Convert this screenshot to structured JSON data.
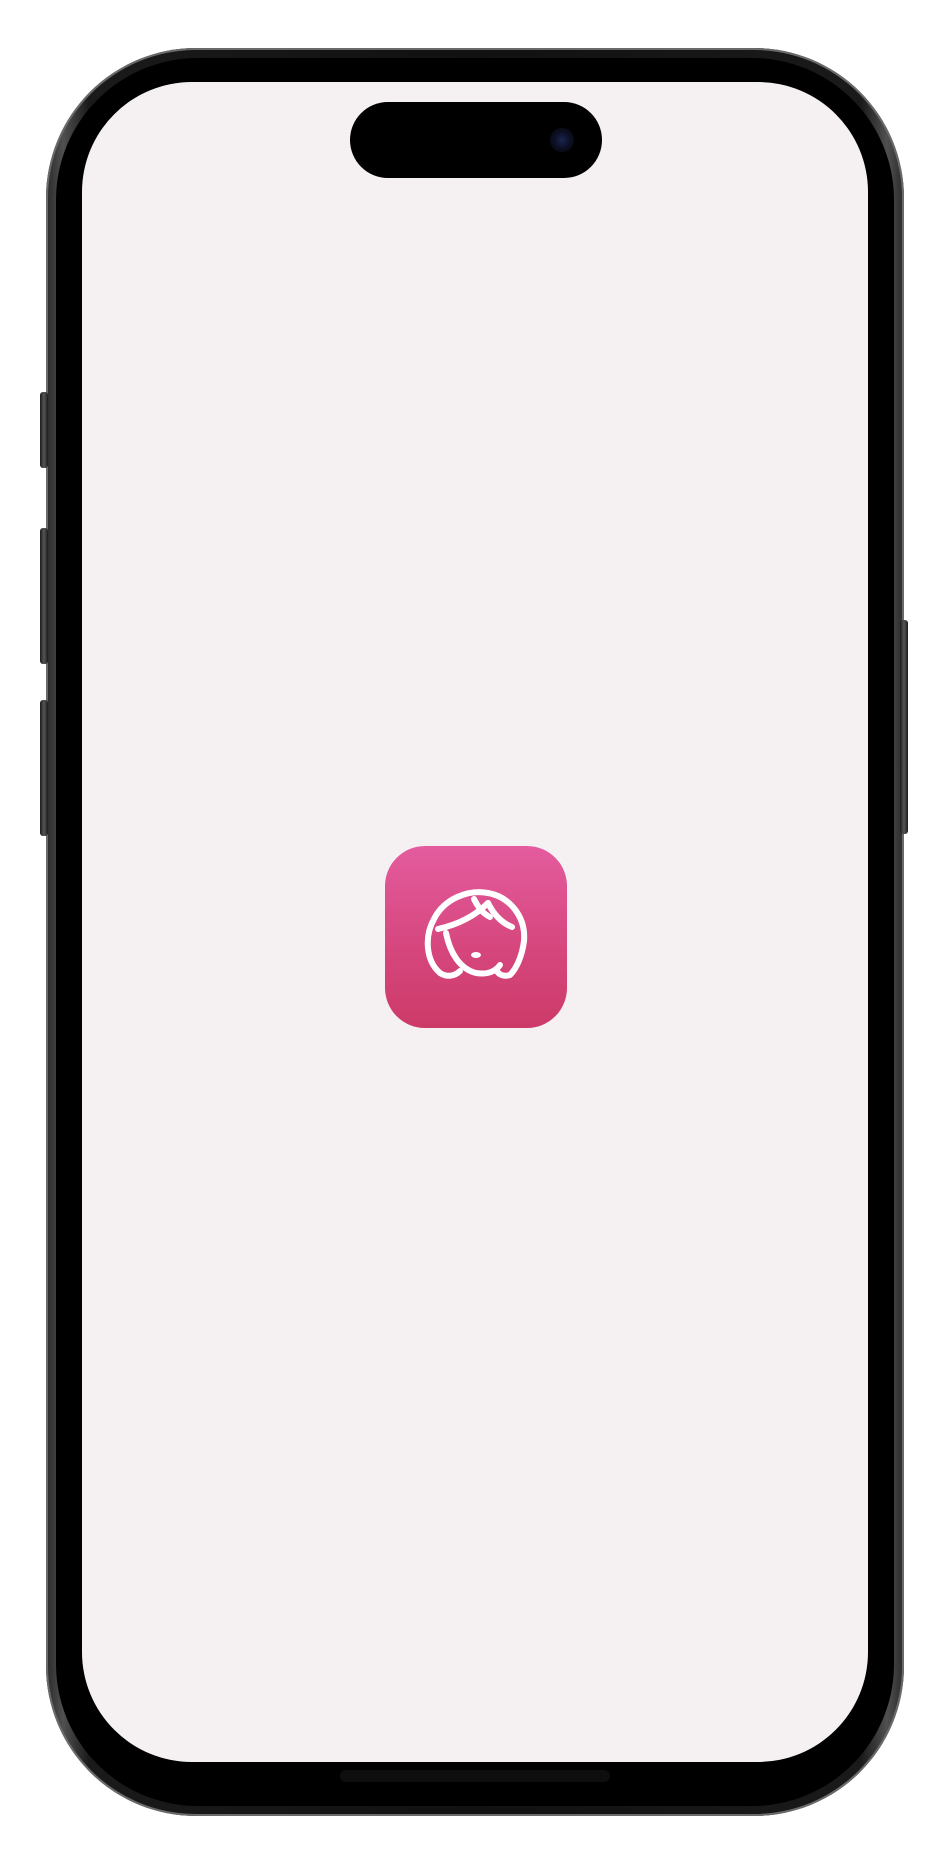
{
  "device": {
    "frame_color": "#111111",
    "screen_background": "#f5f1f3"
  },
  "splash": {
    "app_icon": {
      "icon_name": "woman-face-icon",
      "gradient_top": "#e45c9e",
      "gradient_bottom": "#cc3a68",
      "glyph_color": "#ffffff"
    }
  }
}
